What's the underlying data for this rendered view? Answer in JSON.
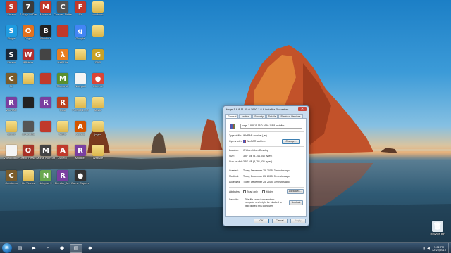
{
  "colors": {
    "dialog_bg": "#c9dcef",
    "taskbar": "#1c3348",
    "close_button": "#c9453a"
  },
  "desktop_icons": [
    {
      "label": "Steam",
      "icon": "steam-icon",
      "color": "#c0392b",
      "glyph": "S"
    },
    {
      "label": "7 Days to Die",
      "icon": "game-7-icon",
      "color": "#3b3b3b",
      "glyph": "7"
    },
    {
      "label": "Minecraft",
      "icon": "game-icon",
      "color": "#c0392b",
      "glyph": "M"
    },
    {
      "label": "Counter-Strike",
      "icon": "cs-icon",
      "color": "#555555",
      "glyph": "C"
    },
    {
      "label": "FX",
      "icon": "game-icon",
      "color": "#c0392b",
      "glyph": "F"
    },
    {
      "label": "modsmc",
      "icon": "folder-icon",
      "color": "#e4c060",
      "glyph": ""
    },
    {
      "label": "Skype",
      "icon": "skype-icon",
      "color": "#1e9be0",
      "glyph": "S"
    },
    {
      "label": "Origin",
      "icon": "origin-icon",
      "color": "#e2711d",
      "glyph": "O"
    },
    {
      "label": "Blackout",
      "icon": "game-icon",
      "color": "#222222",
      "glyph": "B"
    },
    {
      "label": "",
      "icon": "game-icon",
      "color": "#c0392b",
      "glyph": ""
    },
    {
      "label": "Google",
      "icon": "google-icon",
      "color": "#4285f4",
      "glyph": "g"
    },
    {
      "label": "",
      "icon": "folder-icon",
      "color": "#e4c060",
      "glyph": ""
    },
    {
      "label": "Steam",
      "icon": "steam-icon",
      "color": "#1b2838",
      "glyph": "S"
    },
    {
      "label": "Wildstar",
      "icon": "game-icon",
      "color": "#b03030",
      "glyph": "W"
    },
    {
      "label": "",
      "icon": "game-icon",
      "color": "#444444",
      "glyph": ""
    },
    {
      "label": "Half-Life",
      "icon": "hl-icon",
      "color": "#e67e22",
      "glyph": "λ"
    },
    {
      "label": "",
      "icon": "folder-icon",
      "color": "#e4c060",
      "glyph": ""
    },
    {
      "label": "GIGI",
      "icon": "game-icon",
      "color": "#c9a227",
      "glyph": "G"
    },
    {
      "label": "Cit",
      "icon": "game-icon",
      "color": "#7a5c2b",
      "glyph": "C"
    },
    {
      "label": "",
      "icon": "folder-icon",
      "color": "#e4c060",
      "glyph": ""
    },
    {
      "label": "",
      "icon": "game-icon",
      "color": "#c0392b",
      "glyph": ""
    },
    {
      "label": "Minecraft",
      "icon": "minecraft-icon",
      "color": "#5a8f2e",
      "glyph": "M"
    },
    {
      "label": "Notepad",
      "icon": "document-icon",
      "color": "#f0f0f0",
      "glyph": ""
    },
    {
      "label": "Chrome",
      "icon": "chrome-icon",
      "color": "#db4437",
      "glyph": "●"
    },
    {
      "label": "WinRAR",
      "icon": "winrar-icon",
      "color": "#7a3fa0",
      "glyph": "R"
    },
    {
      "label": "",
      "icon": "game-icon",
      "color": "#222222",
      "glyph": ""
    },
    {
      "label": "",
      "icon": "winrar-icon",
      "color": "#7a3fa0",
      "glyph": "R"
    },
    {
      "label": "Rust",
      "icon": "game-icon",
      "color": "#b8401f",
      "glyph": "R"
    },
    {
      "label": "PCSX2 1.2.0",
      "icon": "folder-icon",
      "color": "#e4c060",
      "glyph": ""
    },
    {
      "label": "Mario",
      "icon": "folder-icon",
      "color": "#e4c060",
      "glyph": ""
    },
    {
      "label": "server",
      "icon": "folder-icon",
      "color": "#e4c060",
      "glyph": ""
    },
    {
      "label": "server.bat",
      "icon": "batch-icon",
      "color": "#555555",
      "glyph": ""
    },
    {
      "label": "",
      "icon": "game-icon",
      "color": "#c0392b",
      "glyph": ""
    },
    {
      "label": "Mario",
      "icon": "folder-icon",
      "color": "#e4c060",
      "glyph": ""
    },
    {
      "label": "Acronis",
      "icon": "game-icon",
      "color": "#d35400",
      "glyph": "A"
    },
    {
      "label": "jogos",
      "icon": "folder-icon",
      "color": "#e4c060",
      "glyph": ""
    },
    {
      "label": "Video Editor",
      "icon": "document-icon",
      "color": "#f0f0f0",
      "glyph": ""
    },
    {
      "label": "Out of Reach",
      "icon": "game-icon",
      "color": "#a93226",
      "glyph": "O"
    },
    {
      "label": "Mortal Kombat",
      "icon": "game-icon",
      "color": "#444444",
      "glyph": "M"
    },
    {
      "label": "Arkeol",
      "icon": "game-icon",
      "color": "#c0392b",
      "glyph": "A"
    },
    {
      "label": "Monster",
      "icon": "winrar-icon",
      "color": "#7a3fa0",
      "glyph": "R"
    },
    {
      "label": "Website",
      "icon": "folder-icon",
      "color": "#e4c060",
      "glyph": ""
    },
    {
      "label": "Creaturas",
      "icon": "game-icon",
      "color": "#7a5c2b",
      "glyph": "C"
    },
    {
      "label": "Hd Videos",
      "icon": "folder-icon",
      "color": "#e4c060",
      "glyph": ""
    },
    {
      "label": "Notepad++",
      "icon": "notepad-icon",
      "color": "#6aa84f",
      "glyph": "N"
    },
    {
      "label": "Blender_M...",
      "icon": "winrar-icon",
      "color": "#7a3fa0",
      "glyph": "R"
    },
    {
      "label": "Game Capture",
      "icon": "capture-icon",
      "color": "#333333",
      "glyph": "●"
    },
    {
      "label": "Recycle Bin",
      "icon": "recycle-bin-icon",
      "color": "#dfe8ef",
      "glyph": "🗑"
    }
  ],
  "dialog": {
    "title": "forge-1.8.8-11.15.0.1650-1.8.8-installer Properties",
    "close_glyph": "✕",
    "tabs": [
      "General",
      "Archive",
      "Security",
      "Details",
      "Previous Versions"
    ],
    "file_name": "forge-1.8.8-11.15.0.1650-1.8.8-installer",
    "type_label": "Type of file:",
    "type_value": "WinRAR archive (.jar)",
    "opens_label": "Opens with:",
    "opens_value": "WinRAR archiver",
    "change_button": "Change...",
    "location_label": "Location:",
    "location_value": "C:\\Users\\User\\Desktop",
    "size_label": "Size:",
    "size_value": "3.57 MB (3,744,548 bytes)",
    "size_on_disk_label": "Size on disk:",
    "size_on_disk_value": "3.57 MB (3,751,936 bytes)",
    "created_label": "Created:",
    "created_value": "Today, December 25, 2015, 3 minutes ago",
    "modified_label": "Modified:",
    "modified_value": "Today, December 25, 2015, 3 minutes ago",
    "accessed_label": "Accessed:",
    "accessed_value": "Today, December 25, 2015, 3 minutes ago",
    "attributes_label": "Attributes:",
    "readonly_label": "Read only",
    "hidden_label": "Hidden",
    "advanced_button": "Advanced...",
    "security_label": "Security:",
    "security_text_1": "This file came from another",
    "security_text_2": "computer and might be blocked to",
    "security_text_3": "help protect this computer.",
    "unblock_button": "Unblock",
    "ok_button": "OK",
    "cancel_button": "Cancel",
    "apply_button": "Apply"
  },
  "taskbar": {
    "items": [
      {
        "name": "explorer",
        "icon": "folder-icon",
        "glyph": "▤",
        "active": false
      },
      {
        "name": "media-player",
        "icon": "media-player-icon",
        "glyph": "▶",
        "active": false
      },
      {
        "name": "internet-explorer",
        "icon": "ie-icon",
        "glyph": "e",
        "active": false
      },
      {
        "name": "chrome",
        "icon": "chrome-icon",
        "glyph": "●",
        "active": false
      },
      {
        "name": "explorer-window",
        "icon": "folder-icon",
        "glyph": "▤",
        "active": true
      },
      {
        "name": "game",
        "icon": "game-icon",
        "glyph": "◆",
        "active": false
      }
    ],
    "time": "3:02 PM",
    "date": "12/25/2015"
  }
}
